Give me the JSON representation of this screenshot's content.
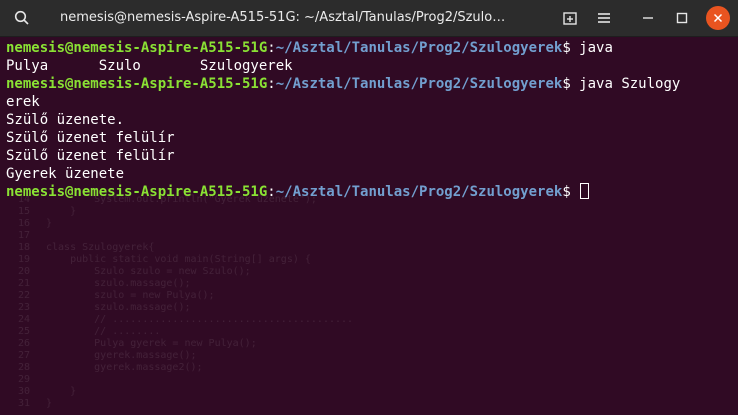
{
  "window": {
    "title": "nemesis@nemesis-Aspire-A515-51G: ~/Asztal/Tanulas/Prog2/Szulo…",
    "icons": {
      "search": "search-icon",
      "new_tab": "new-tab-icon",
      "menu": "hamburger-menu-icon",
      "minimize": "minimize-icon",
      "maximize": "maximize-icon",
      "close": "close-icon"
    },
    "close_color": "#e95420"
  },
  "terminal": {
    "background": "#300a24",
    "user_color": "#8ae234",
    "path_color": "#729fcf",
    "prompt_user": "nemesis@nemesis-Aspire-A515-51G",
    "prompt_path": "~/Asztal/Tanulas/Prog2/Szulogyerek",
    "command1": "$ java",
    "output1": "Pulya      Szulo       Szulogyerek",
    "command2": "$ java Szulogy",
    "command2_wrap": "erek",
    "output2": "Szülő üzenete.",
    "output3": "Szülő üzenet felülír",
    "output4": "Szülő üzenet felülír",
    "output5": "Gyerek üzenete",
    "prompt_end": "$"
  }
}
